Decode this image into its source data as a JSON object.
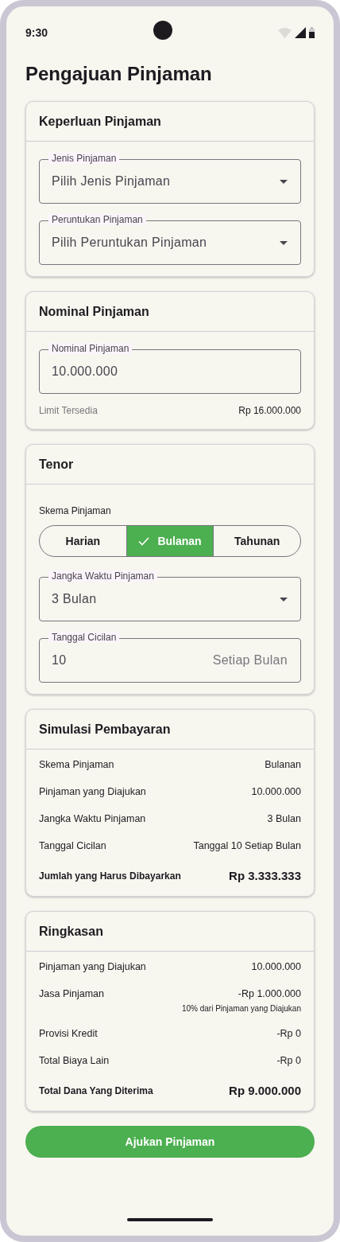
{
  "status_bar": {
    "time": "9:30"
  },
  "title": "Pengajuan Pinjaman",
  "sections": [
    {
      "title": "Keperluan Pinjaman",
      "blocks": [
        {
          "kind": "select",
          "label": "Jenis Pinjaman",
          "value": "Pilih Jenis Pinjaman"
        },
        {
          "kind": "select",
          "label": "Peruntukan Pinjaman",
          "value": "Pilih Peruntukan Pinjaman"
        }
      ]
    },
    {
      "title": "Nominal Pinjaman",
      "blocks": [
        {
          "kind": "input",
          "label": "Nominal Pinjaman",
          "value": "10.000.000"
        },
        {
          "kind": "note",
          "label": "Limit Tersedia",
          "value": "Rp 16.000.000"
        }
      ]
    },
    {
      "title": "Tenor",
      "blocks": [
        {
          "kind": "caption",
          "text": "Skema Pinjaman"
        },
        {
          "kind": "segmented",
          "options": [
            {
              "label": "Harian",
              "selected": false
            },
            {
              "label": "Bulanan",
              "selected": true
            },
            {
              "label": "Tahunan",
              "selected": false
            }
          ]
        },
        {
          "kind": "select",
          "label": "Jangka Waktu Pinjaman",
          "value": "3 Bulan"
        },
        {
          "kind": "input",
          "label": "Tanggal Cicilan",
          "value": "10",
          "suffix": "Setiap Bulan"
        }
      ]
    },
    {
      "title": "Simulasi Pembayaran",
      "blocks": [
        {
          "kind": "row",
          "label": "Skema Pinjaman",
          "value": "Bulanan"
        },
        {
          "kind": "row",
          "label": "Pinjaman yang Diajukan",
          "value": "10.000.000"
        },
        {
          "kind": "row",
          "label": "Jangka Waktu Pinjaman",
          "value": "3 Bulan"
        },
        {
          "kind": "row",
          "label": "Tanggal Cicilan",
          "value": "Tanggal 10 Setiap Bulan"
        },
        {
          "kind": "total",
          "label": "Jumlah yang Harus Dibayarkan",
          "value": "Rp 3.333.333"
        }
      ]
    },
    {
      "title": "Ringkasan",
      "blocks": [
        {
          "kind": "row",
          "label": "Pinjaman yang Diajukan",
          "value": "10.000.000"
        },
        {
          "kind": "row",
          "label": "Jasa Pinjaman",
          "value": "-Rp 1.000.000",
          "note": "10% dari Pinjaman yang Diajukan"
        },
        {
          "kind": "row",
          "label": "Provisi Kredit",
          "value": "-Rp 0"
        },
        {
          "kind": "row",
          "label": "Total Biaya Lain",
          "value": "-Rp 0"
        },
        {
          "kind": "total",
          "label": "Total Dana Yang Diterima",
          "value": "Rp 9.000.000"
        }
      ]
    }
  ],
  "submit_button": "Ajukan Pinjaman"
}
